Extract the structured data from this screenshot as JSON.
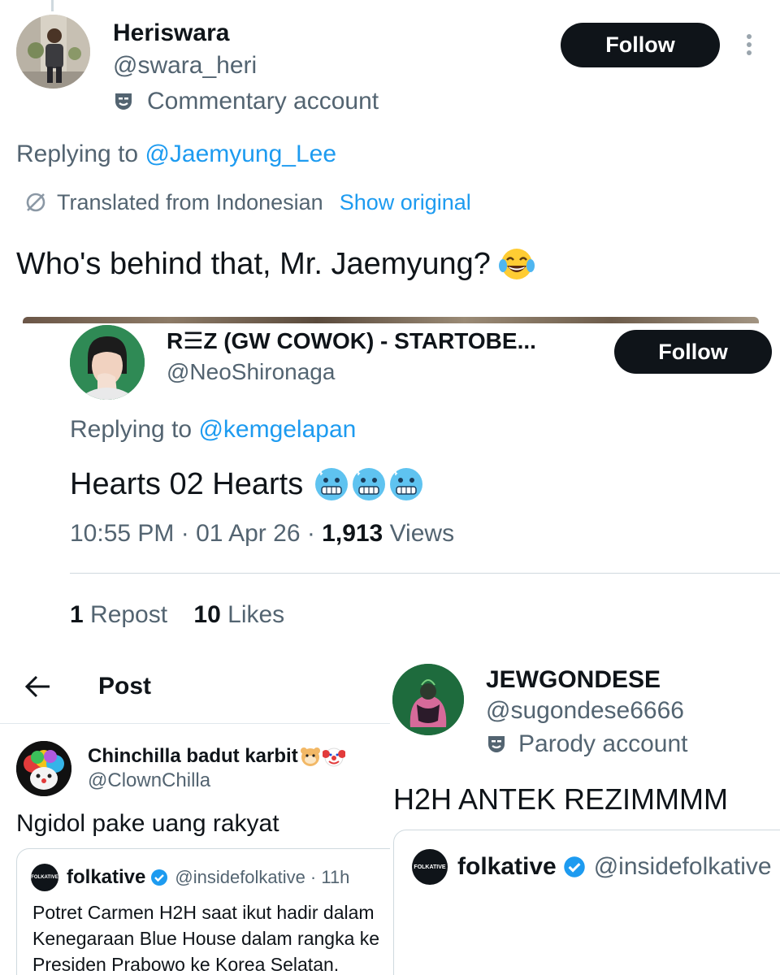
{
  "p1": {
    "name": "Heriswara",
    "handle": "@swara_heri",
    "account_label": "Commentary account",
    "follow_label": "Follow",
    "replying_prefix": "Replying to ",
    "replying_handle": "@Jaemyung_Lee",
    "translated_label": "Translated from Indonesian",
    "show_original_label": "Show original",
    "text": "Who's behind that, Mr. Jaemyung?",
    "emoji_icon": "tears-of-joy-emoji"
  },
  "p2": {
    "name": "R☰Z (GW COWOK) - STARTOBE...",
    "handle": "@NeoShironaga",
    "follow_label": "Follow",
    "replying_prefix": "Replying to ",
    "replying_handle": "@kemgelapan",
    "text": "Hearts 02 Hearts",
    "emoji_icon": "cold-face-emoji",
    "time": "10:55 PM · 01 Apr 26 · ",
    "views_count": "1,913",
    "views_label": " Views",
    "reposts_count": "1",
    "reposts_label": " Repost",
    "likes_count": "10",
    "likes_label": " Likes"
  },
  "p3": {
    "header_title": "Post",
    "name": "Chinchilla badut karbit",
    "handle": "@ClownChilla",
    "text": "Ngidol pake uang rakyat",
    "quote": {
      "name": "folkative",
      "handle": "@insidefolkative",
      "time": "· 11h",
      "logo_text": "FOLKATIVE",
      "line1": "Potret Carmen H2H saat ikut hadir dalam",
      "line2": "Kenegaraan Blue House dalam rangka ke",
      "line3": "Presiden Prabowo ke Korea Selatan."
    }
  },
  "p4": {
    "name": "JEWGONDESE",
    "handle": "@sugondese6666",
    "account_label": "Parody account",
    "text": "H2H ANTEK REZIMMMM",
    "quote": {
      "name": "folkative",
      "handle": "@insidefolkative",
      "logo_text": "FOLKATIVE"
    }
  },
  "colors": {
    "text": "#0f1419",
    "muted": "#536471",
    "link": "#1d9bf0",
    "verified": "#1d9bf0",
    "button": "#0f1419"
  }
}
